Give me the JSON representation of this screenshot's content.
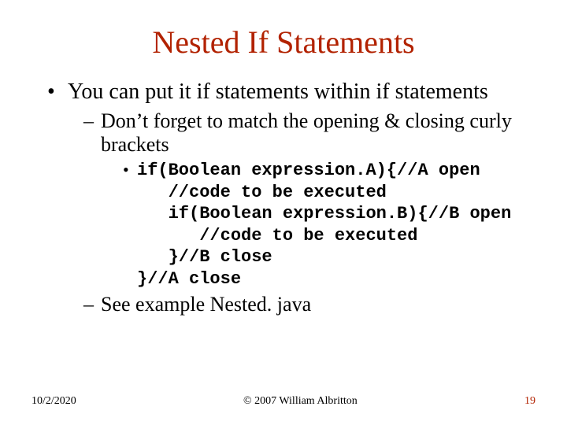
{
  "title": "Nested If Statements",
  "bullets": {
    "l1": "You can put it if statements within if statements",
    "l2a": "Don’t forget to match the opening & closing curly brackets",
    "code": "if(Boolean expression.A){//A open\n   //code to be executed\n   if(Boolean expression.B){//B open\n      //code to be executed\n   }//B close\n}//A close",
    "l2b": "See example Nested. java"
  },
  "footer": {
    "date": "10/2/2020",
    "copyright": "© 2007 William Albritton",
    "page": "19"
  }
}
